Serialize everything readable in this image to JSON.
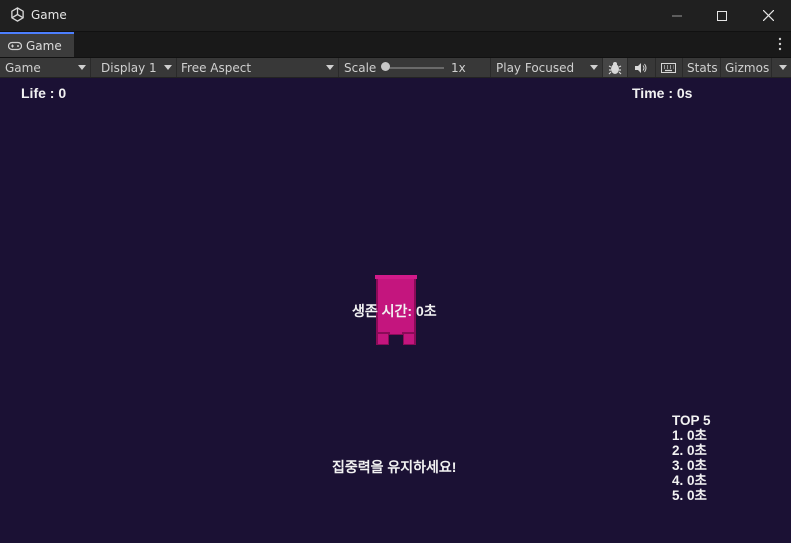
{
  "window": {
    "title": "Game"
  },
  "tab": {
    "label": "Game"
  },
  "toolbar": {
    "view_mode": "Game",
    "display": "Display 1",
    "aspect": "Free Aspect",
    "scale_label": "Scale",
    "scale_value": "1x",
    "scale_fraction": 0,
    "play_mode": "Play Focused",
    "stats": "Stats",
    "gizmos": "Gizmos"
  },
  "hud": {
    "life": "Life : 0",
    "time": "Time : 0s",
    "survival": "생존 시간: 0초",
    "focus_message": "집중력을 유지하세요!"
  },
  "leaderboard": {
    "title": "TOP 5",
    "entries": [
      "1. 0초",
      "2. 0초",
      "3. 0초",
      "4. 0초",
      "5. 0초"
    ]
  },
  "colors": {
    "viewport_bg": "#1b1134",
    "player": "#c4157e",
    "accent": "#4c7fff"
  }
}
